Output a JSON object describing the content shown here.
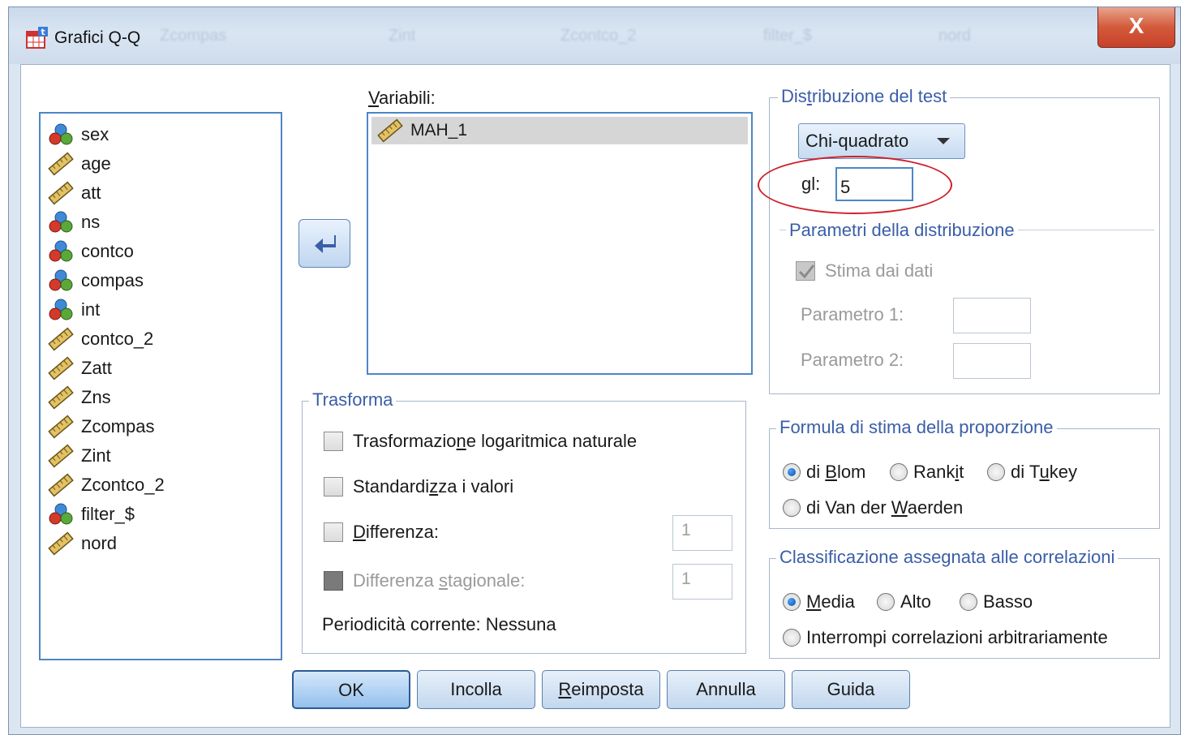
{
  "window": {
    "title": "Grafici Q-Q",
    "close_label": "X",
    "background_titles": [
      "Zcompas",
      "Zint",
      "Zcontco_2",
      "filter_$",
      "nord"
    ]
  },
  "variables": [
    {
      "name": "sex",
      "icon": "nominal-icon"
    },
    {
      "name": "age",
      "icon": "scale-icon"
    },
    {
      "name": "att",
      "icon": "scale-icon"
    },
    {
      "name": "ns",
      "icon": "nominal-icon"
    },
    {
      "name": "contco",
      "icon": "nominal-icon"
    },
    {
      "name": "compas",
      "icon": "nominal-icon"
    },
    {
      "name": "int",
      "icon": "nominal-icon"
    },
    {
      "name": "contco_2",
      "icon": "scale-icon"
    },
    {
      "name": "Zatt",
      "icon": "scale-icon"
    },
    {
      "name": "Zns",
      "icon": "scale-icon"
    },
    {
      "name": "Zcompas",
      "icon": "scale-icon"
    },
    {
      "name": "Zint",
      "icon": "scale-icon"
    },
    {
      "name": "Zcontco_2",
      "icon": "scale-icon"
    },
    {
      "name": "filter_$",
      "icon": "nominal-icon"
    },
    {
      "name": "nord",
      "icon": "scale-icon"
    }
  ],
  "target": {
    "label_first": "V",
    "label_rest": "ariabili:",
    "items": [
      "MAH_1"
    ]
  },
  "transform": {
    "title": "Trasforma",
    "log_pre": "Trasformazio",
    "log_key": "n",
    "log_post": "e logaritmica naturale",
    "std_pre": "Standardi",
    "std_key": "z",
    "std_post": "za i valori",
    "diff_key": "D",
    "diff_post": "ifferenza:",
    "diff_value": "1",
    "season_pre": "Differenza ",
    "season_key": "s",
    "season_post": "tagionale:",
    "season_value": "1",
    "periodicity": "Periodicità corrente: Nessuna"
  },
  "distribution": {
    "title_pre": "Dis",
    "title_key": "t",
    "title_post": "ribuzione del test",
    "selected": "Chi-quadrato",
    "gl_label": "gl:",
    "gl_value": "5",
    "params_title": "Parametri della distribuzione",
    "estimate_label": "Stima dai dati",
    "param1_label": "Parametro 1:",
    "param2_label": "Parametro 2:"
  },
  "proportion": {
    "title": "Formula di stima della proporzione",
    "blom_pre": "di ",
    "blom_key": "B",
    "blom_post": "lom",
    "rankit_pre": "Rank",
    "rankit_key": "i",
    "rankit_post": "t",
    "tukey_pre": "di T",
    "tukey_key": "u",
    "tukey_post": "key",
    "vdw_pre": "di Van der ",
    "vdw_key": "W",
    "vdw_post": "aerden",
    "selected": "di Blom"
  },
  "ties": {
    "title": "Classificazione assegnata alle correlazioni",
    "media_key": "M",
    "media_post": "edia",
    "alto": "Alto",
    "basso": "Basso",
    "break": "Interrompi correlazioni arbitrariamente",
    "selected": "Media"
  },
  "buttons": {
    "ok": "OK",
    "paste": "Incolla",
    "reset_key": "R",
    "reset_post": "eimposta",
    "cancel": "Annulla",
    "help": "Guida"
  },
  "colors": {
    "accent": "#3a5ea8",
    "annotation": "#d0202a",
    "list_border": "#4d86c6"
  }
}
